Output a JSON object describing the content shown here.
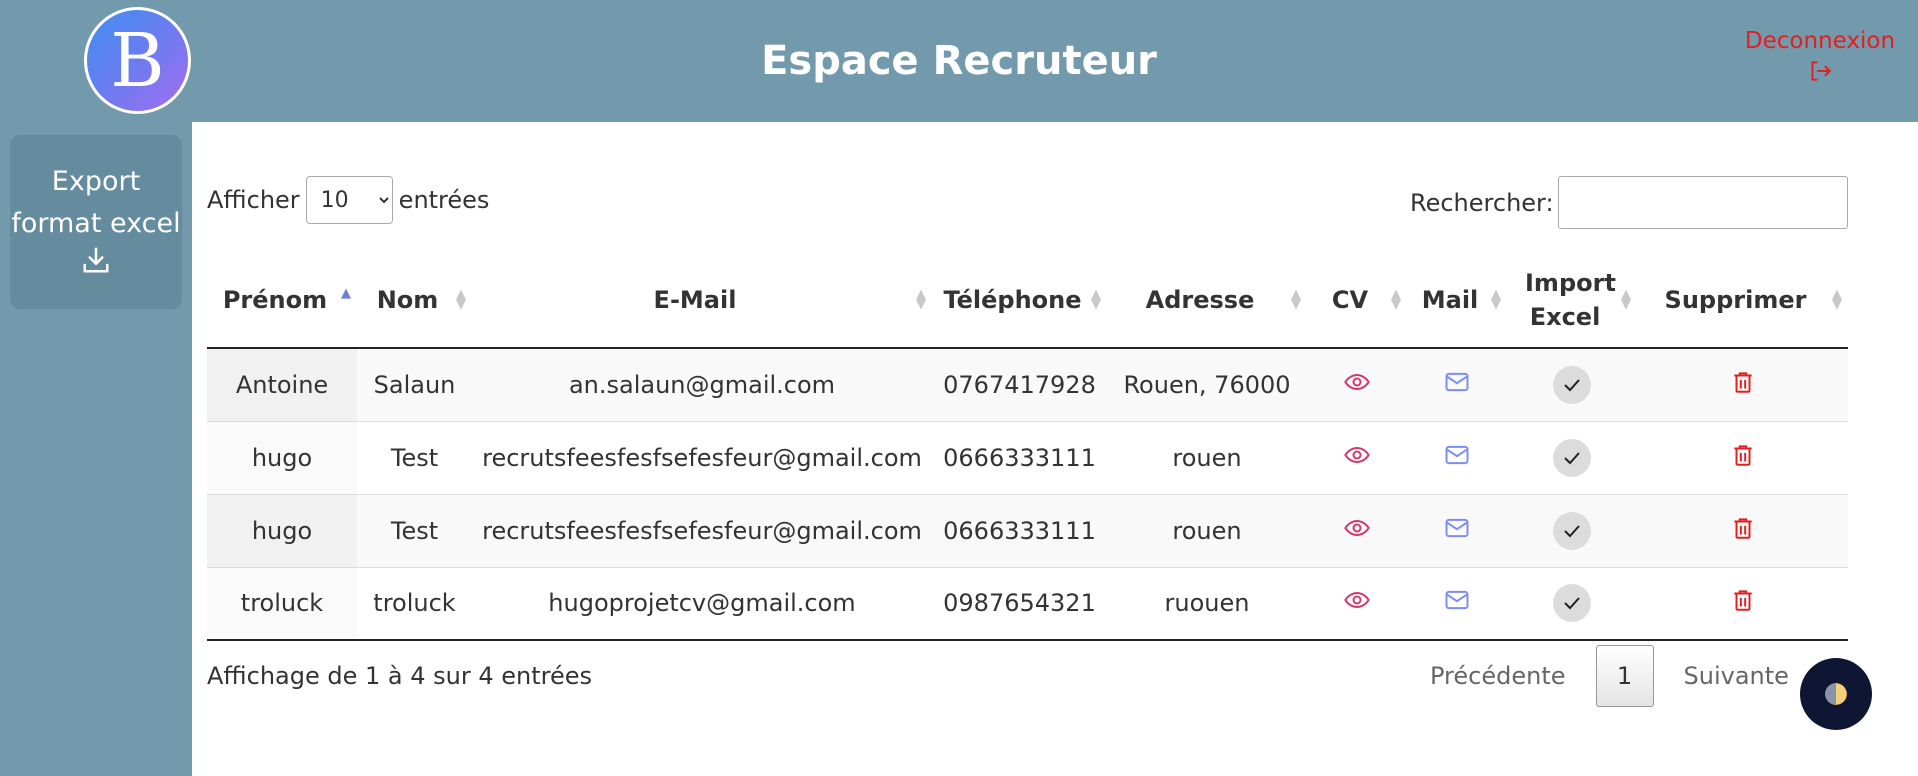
{
  "header": {
    "logo_letter": "B",
    "title": "Espace Recruteur",
    "logout_label": "Deconnexion"
  },
  "sidebar": {
    "export_line1": "Export",
    "export_line2": "format excel",
    "export_icon": "download-icon"
  },
  "table_controls": {
    "show_label": "Afficher",
    "entries_label": "entrées",
    "page_length": "10",
    "search_label": "Rechercher:",
    "search_value": ""
  },
  "columns": [
    "Prénom",
    "Nom",
    "E-Mail",
    "Téléphone",
    "Adresse",
    "CV",
    "Mail",
    "Import Excel",
    "Supprimer"
  ],
  "rows": [
    {
      "prenom": "Antoine",
      "nom": "Salaun",
      "email": "an.salaun@gmail.com",
      "telephone": "0767417928",
      "adresse": "Rouen, 76000"
    },
    {
      "prenom": "hugo",
      "nom": "Test",
      "email": "recrutsfeesfesfsefesfeur@gmail.com",
      "telephone": "0666333111",
      "adresse": "rouen"
    },
    {
      "prenom": "hugo",
      "nom": "Test",
      "email": "recrutsfeesfesfsefesfeur@gmail.com",
      "telephone": "0666333111",
      "adresse": "rouen"
    },
    {
      "prenom": "troluck",
      "nom": "troluck",
      "email": "hugoprojetcv@gmail.com",
      "telephone": "0987654321",
      "adresse": "ruouen"
    }
  ],
  "footer": {
    "info": "Affichage de 1 à 4 sur 4 entrées",
    "prev_label": "Précédente",
    "current_page": "1",
    "next_label": "Suivante"
  },
  "colors": {
    "header_bg": "#7399ad",
    "logout": "#e0201f",
    "cv_icon": "#d4386a",
    "mail_icon": "#7d8ef0",
    "delete_icon": "#e0201f"
  }
}
